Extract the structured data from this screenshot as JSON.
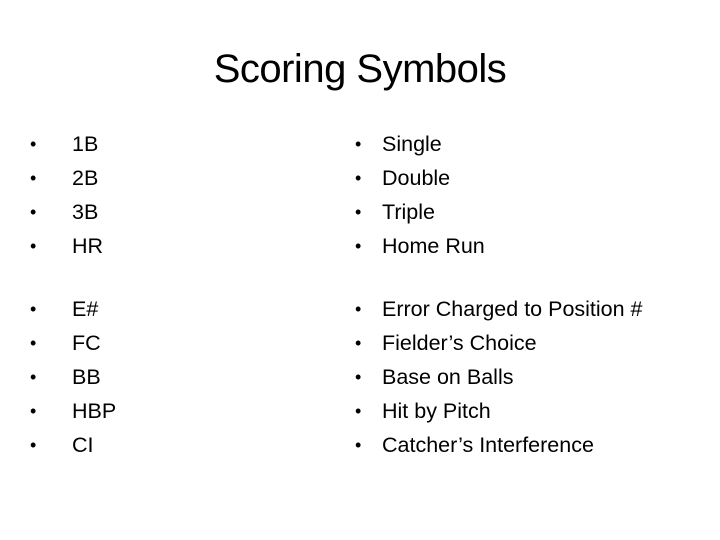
{
  "slide": {
    "title": "Scoring Symbols",
    "bullet_glyph": "•",
    "abbreviations_group_1": [
      "1B",
      "2B",
      "3B",
      "HR"
    ],
    "meanings_group_1": [
      "Single",
      "Double",
      "Triple",
      "Home Run"
    ],
    "abbreviations_group_2": [
      "E#",
      "FC",
      "BB",
      "HBP",
      "CI"
    ],
    "meanings_group_2": [
      "Error Charged to Position #",
      "Fielder’s Choice",
      "Base on Balls",
      "Hit by Pitch",
      "Catcher’s Interference"
    ]
  }
}
